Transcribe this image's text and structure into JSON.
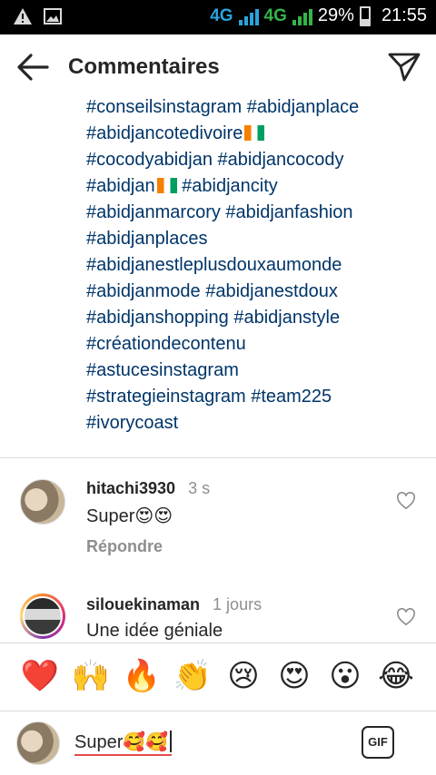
{
  "status_bar": {
    "network_1": "4G",
    "network_2": "4G",
    "battery": "29%",
    "time": "21:55"
  },
  "header": {
    "title": "Commentaires",
    "back_icon": "arrow-left-icon",
    "send_icon": "paper-plane-icon"
  },
  "caption": {
    "lines": [
      "#conseilsinstagram #abidjanplace",
      "#abidjancotedivoire",
      "#cocodyabidjan #abidjancocody",
      "#abidjan",
      "#abidjanmarcory #abidjanfashion",
      "#abidjanplaces",
      "#abidjanestleplusdouxaumonde",
      "#abidjanmode #abidjanestdoux",
      "#abidjanshopping #abidjanstyle",
      "#créationdecontenu",
      "#astucesinstagram",
      "#strategieinstagram #team225",
      "#ivorycoast"
    ],
    "line4_suffix": " #abidjancity"
  },
  "comments": [
    {
      "username": "hitachi3930",
      "time": "3 s",
      "text": "Super😍😍",
      "reply": "Répondre"
    },
    {
      "username": "silouekinaman",
      "time": "1 jours",
      "text": "Une idée géniale"
    }
  ],
  "emoji_bar": [
    "❤️",
    "🙌",
    "🔥",
    "👏",
    "😢",
    "😍",
    "😮",
    "😂"
  ],
  "input": {
    "value": "Super🥰🥰",
    "gif_label": "GIF"
  }
}
